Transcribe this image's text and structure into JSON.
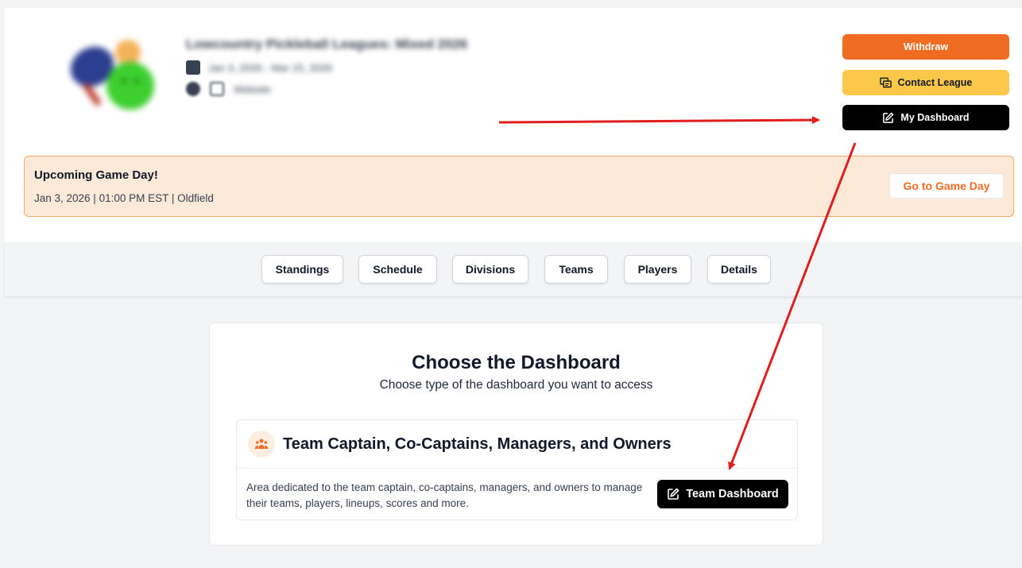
{
  "league": {
    "title": "Lowcountry Pickleball Leagues: Mixed 2026",
    "dates": "Jan 3, 2026 - Mar 15, 2026",
    "website_label": "Website"
  },
  "actions": {
    "withdraw_label": "Withdraw",
    "contact_label": "Contact League",
    "my_dashboard_label": "My Dashboard"
  },
  "game_day": {
    "title": "Upcoming Game Day!",
    "info": "Jan 3, 2026 | 01:00 PM EST  |  Oldfield",
    "button_label": "Go to Game Day"
  },
  "tabs": [
    {
      "label": "Standings"
    },
    {
      "label": "Schedule"
    },
    {
      "label": "Divisions"
    },
    {
      "label": "Teams"
    },
    {
      "label": "Players"
    },
    {
      "label": "Details"
    }
  ],
  "dashboard_chooser": {
    "title": "Choose the Dashboard",
    "subtitle": "Choose type of the dashboard you want to access",
    "option": {
      "title": "Team Captain, Co-Captains, Managers, and Owners",
      "description": "Area dedicated to the team captain, co-captains, managers, and owners to manage their teams, players, lineups, scores and more.",
      "button_label": "Team Dashboard"
    }
  },
  "colors": {
    "brand_orange": "#f06c23",
    "contact_yellow": "#fcc849",
    "banner_bg": "#fde9d7",
    "annotation_red": "#e01e1e"
  },
  "icons": {
    "calendar": "calendar-icon",
    "facebook": "facebook-icon",
    "instagram": "instagram-icon",
    "contact": "contact-card-icon",
    "edit": "edit-icon",
    "team": "team-people-icon"
  }
}
